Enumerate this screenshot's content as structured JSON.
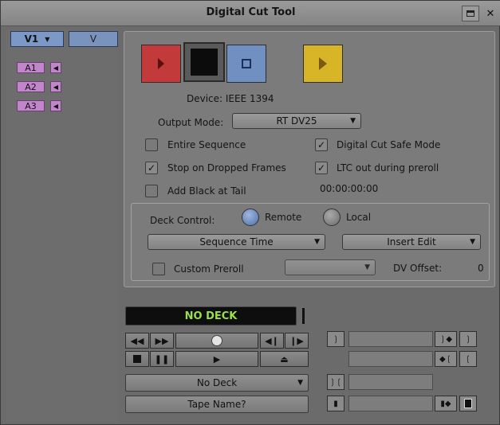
{
  "window": {
    "title": "Digital Cut Tool"
  },
  "tracks": {
    "video_active": "V1",
    "video_other": "V",
    "audio": [
      "A1",
      "A2",
      "A3"
    ]
  },
  "device": {
    "label": "Device: IEEE 1394"
  },
  "output_mode": {
    "label": "Output Mode:",
    "value": "RT DV25"
  },
  "options": {
    "entire_sequence": {
      "label": "Entire Sequence",
      "checked": false
    },
    "stop_on_dropped": {
      "label": "Stop on Dropped Frames",
      "checked": true
    },
    "add_black": {
      "label": "Add Black at Tail",
      "checked": false
    },
    "safe_mode": {
      "label": "Digital Cut Safe Mode",
      "checked": true
    },
    "ltc_out": {
      "label": "LTC out during preroll",
      "checked": true
    },
    "timecode": "00:00:00:00"
  },
  "deck_control": {
    "label": "Deck Control:",
    "remote_label": "Remote",
    "local_label": "Local",
    "time_mode": "Sequence Time",
    "edit_mode": "Insert Edit",
    "custom_preroll_label": "Custom Preroll",
    "dv_offset_label": "DV Offset:",
    "dv_offset_value": "0"
  },
  "deck_status": "NO DECK",
  "deck_select": "No Deck",
  "tape_name": "Tape Name?",
  "colors": {
    "record": "#c23a3a",
    "stop": "#0c0c0c",
    "preview": "#6f90c0",
    "play": "#d8b526",
    "status_text": "#9be04a"
  }
}
